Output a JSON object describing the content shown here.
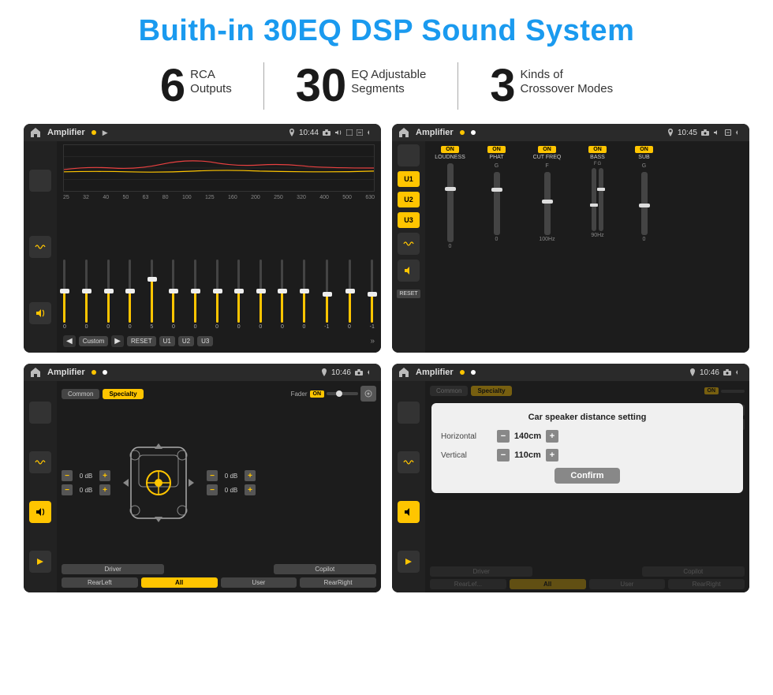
{
  "page": {
    "title": "Buith-in 30EQ DSP Sound System",
    "stats": [
      {
        "number": "6",
        "label": "RCA\nOutputs"
      },
      {
        "number": "30",
        "label": "EQ Adjustable\nSegments"
      },
      {
        "number": "3",
        "label": "Kinds of\nCrossover Modes"
      }
    ],
    "screens": [
      {
        "id": "screen1",
        "topbar": {
          "title": "Amplifier",
          "time": "10:44"
        },
        "type": "eq"
      },
      {
        "id": "screen2",
        "topbar": {
          "title": "Amplifier",
          "time": "10:45"
        },
        "type": "crossover"
      },
      {
        "id": "screen3",
        "topbar": {
          "title": "Amplifier",
          "time": "10:46"
        },
        "type": "speaker"
      },
      {
        "id": "screen4",
        "topbar": {
          "title": "Amplifier",
          "time": "10:46"
        },
        "type": "distance",
        "dialog": {
          "title": "Car speaker distance setting",
          "horizontal_label": "Horizontal",
          "horizontal_value": "140cm",
          "vertical_label": "Vertical",
          "vertical_value": "110cm",
          "confirm_label": "Confirm"
        }
      }
    ],
    "eq": {
      "freqs": [
        "25",
        "32",
        "40",
        "50",
        "63",
        "80",
        "100",
        "125",
        "160",
        "200",
        "250",
        "320",
        "400",
        "500",
        "630"
      ],
      "values": [
        "0",
        "0",
        "0",
        "0",
        "5",
        "0",
        "0",
        "0",
        "0",
        "0",
        "0",
        "0",
        "-1",
        "0",
        "-1"
      ],
      "modes": [
        "Custom",
        "RESET",
        "U1",
        "U2",
        "U3"
      ]
    },
    "crossover": {
      "channels": [
        "LOUDNESS",
        "PHAT",
        "CUT FREQ",
        "BASS",
        "SUB"
      ],
      "u_buttons": [
        "U1",
        "U2",
        "U3"
      ]
    },
    "speaker": {
      "tabs": [
        "Common",
        "Specialty"
      ],
      "fader_label": "Fader",
      "vol_labels": [
        "0 dB",
        "0 dB",
        "0 dB",
        "0 dB"
      ],
      "bottom_btns": [
        "Driver",
        "",
        "Copilot",
        "RearLeft",
        "All",
        "User",
        "RearRight"
      ]
    }
  }
}
